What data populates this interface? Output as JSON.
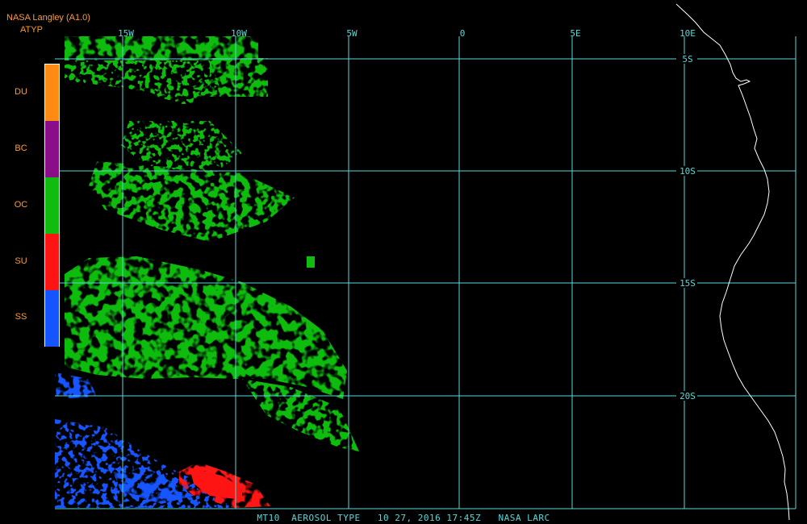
{
  "header": {
    "source": "NASA Langley (A1.0)",
    "product": "ATYP",
    "text_color": "#ff9a30"
  },
  "legend": {
    "items": [
      {
        "label": "DU",
        "color": "#ff8a14"
      },
      {
        "label": "BC",
        "color": "#8a0e8a"
      },
      {
        "label": "OC",
        "color": "#0fbc0f"
      },
      {
        "label": "SU",
        "color": "#ff1414"
      },
      {
        "label": "SS",
        "color": "#1455ff"
      }
    ]
  },
  "map": {
    "grid_color": "#5ad8d8",
    "coast_color": "#ffffff",
    "longitude_labels": [
      "15W",
      "10W",
      "5W",
      "0",
      "5E",
      "10E"
    ],
    "latitude_labels": [
      "5S",
      "10S",
      "15S",
      "20S"
    ]
  },
  "caption": {
    "text": "MT10  AEROSOL TYPE   10 27, 2016 17:45Z   NASA LARC",
    "color": "#5ad8d8"
  }
}
